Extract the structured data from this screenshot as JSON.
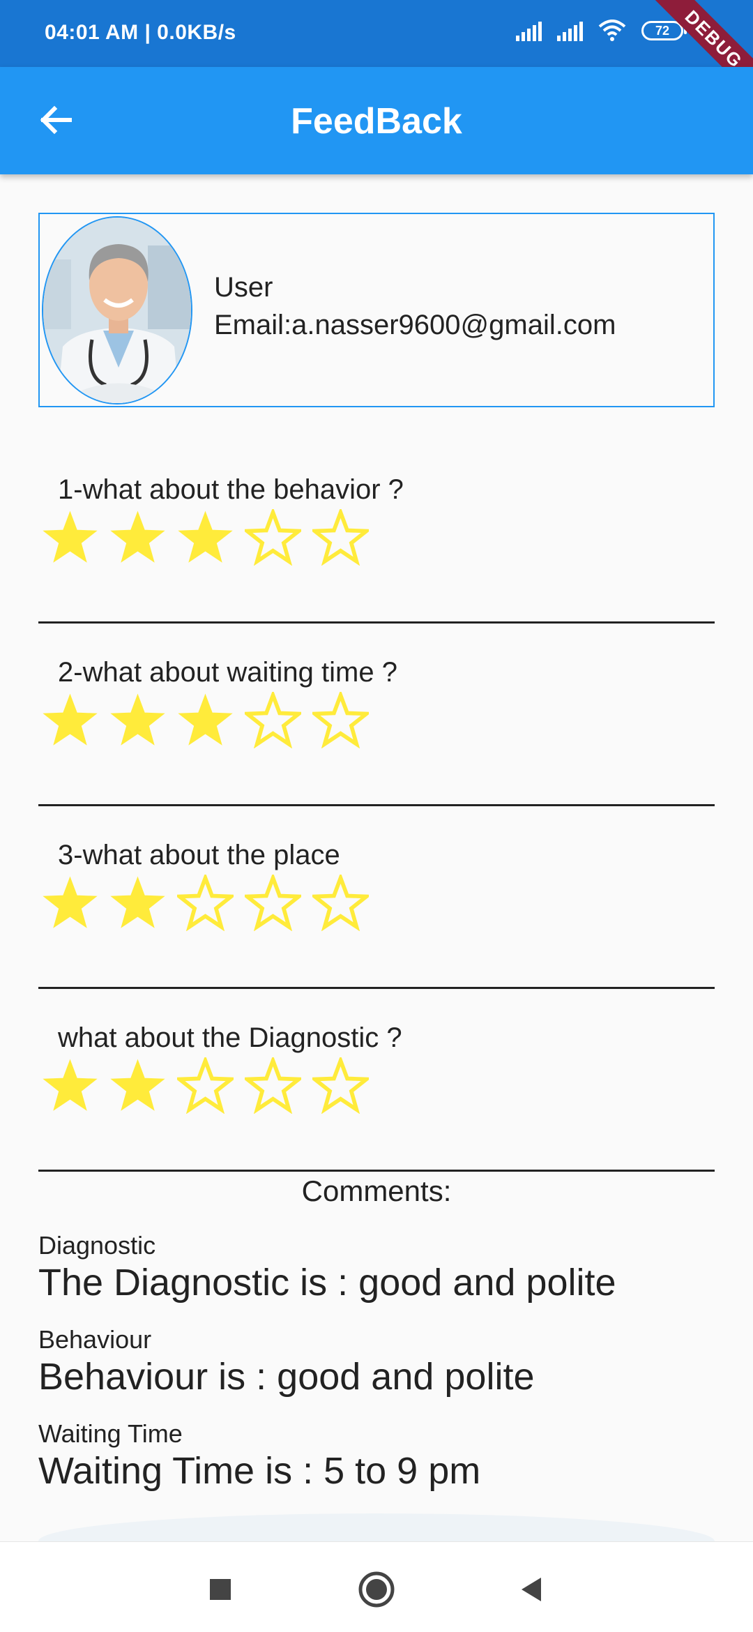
{
  "status_bar": {
    "time": "04:01 AM | 0.0KB/s",
    "battery": "72",
    "debug_banner": "DEBUG"
  },
  "app_bar": {
    "title": "FeedBack",
    "back_icon": "arrow-left-icon"
  },
  "user": {
    "name": "User",
    "email": "Email:a.nasser9600@gmail.com",
    "avatar_icon": "doctor-avatar"
  },
  "questions": [
    {
      "label": "1-what about the behavior ?",
      "rating": 3,
      "max": 5
    },
    {
      "label": "2-what about waiting time ?",
      "rating": 3,
      "max": 5
    },
    {
      "label": "3-what about the place",
      "rating": 2,
      "max": 5
    },
    {
      "label": "what about the Diagnostic ?",
      "rating": 2,
      "max": 5
    }
  ],
  "comments": {
    "title": "Comments:",
    "items": [
      {
        "label": "Diagnostic",
        "value": "The Diagnostic is : good and polite"
      },
      {
        "label": "Behaviour",
        "value": "Behaviour is : good and polite"
      },
      {
        "label": "Waiting Time",
        "value": "Waiting Time is : 5 to 9 pm"
      }
    ]
  },
  "colors": {
    "primary": "#2196f3",
    "status_bar": "#1976d2",
    "star": "#ffeb3b"
  }
}
